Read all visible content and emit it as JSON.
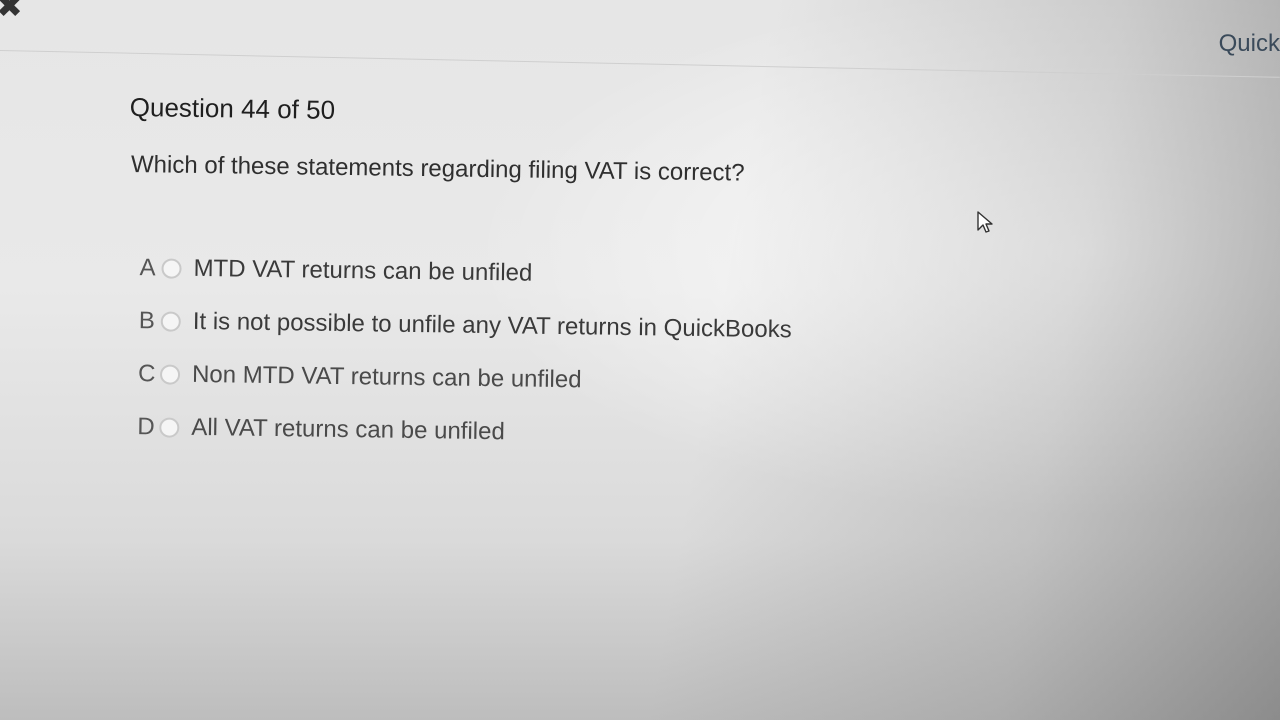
{
  "window": {
    "close_icon": "close-icon",
    "top_link_label": "Quick"
  },
  "quiz": {
    "header": "Question 44 of 50",
    "question": "Which of these statements regarding filing VAT is correct?",
    "options": [
      {
        "letter": "A",
        "text": "MTD VAT returns can be unfiled",
        "selected": false
      },
      {
        "letter": "B",
        "text": "It is not possible to unfile any VAT returns in QuickBooks",
        "selected": false
      },
      {
        "letter": "C",
        "text": "Non MTD VAT returns can be unfiled",
        "selected": false
      },
      {
        "letter": "D",
        "text": "All VAT returns can be unfiled",
        "selected": false
      }
    ]
  },
  "pointer": {
    "icon": "mouse-pointer-icon"
  },
  "colors": {
    "text": "#2b2b2b",
    "link": "#3a4a5a",
    "radio_border": "#c9c9c9"
  }
}
